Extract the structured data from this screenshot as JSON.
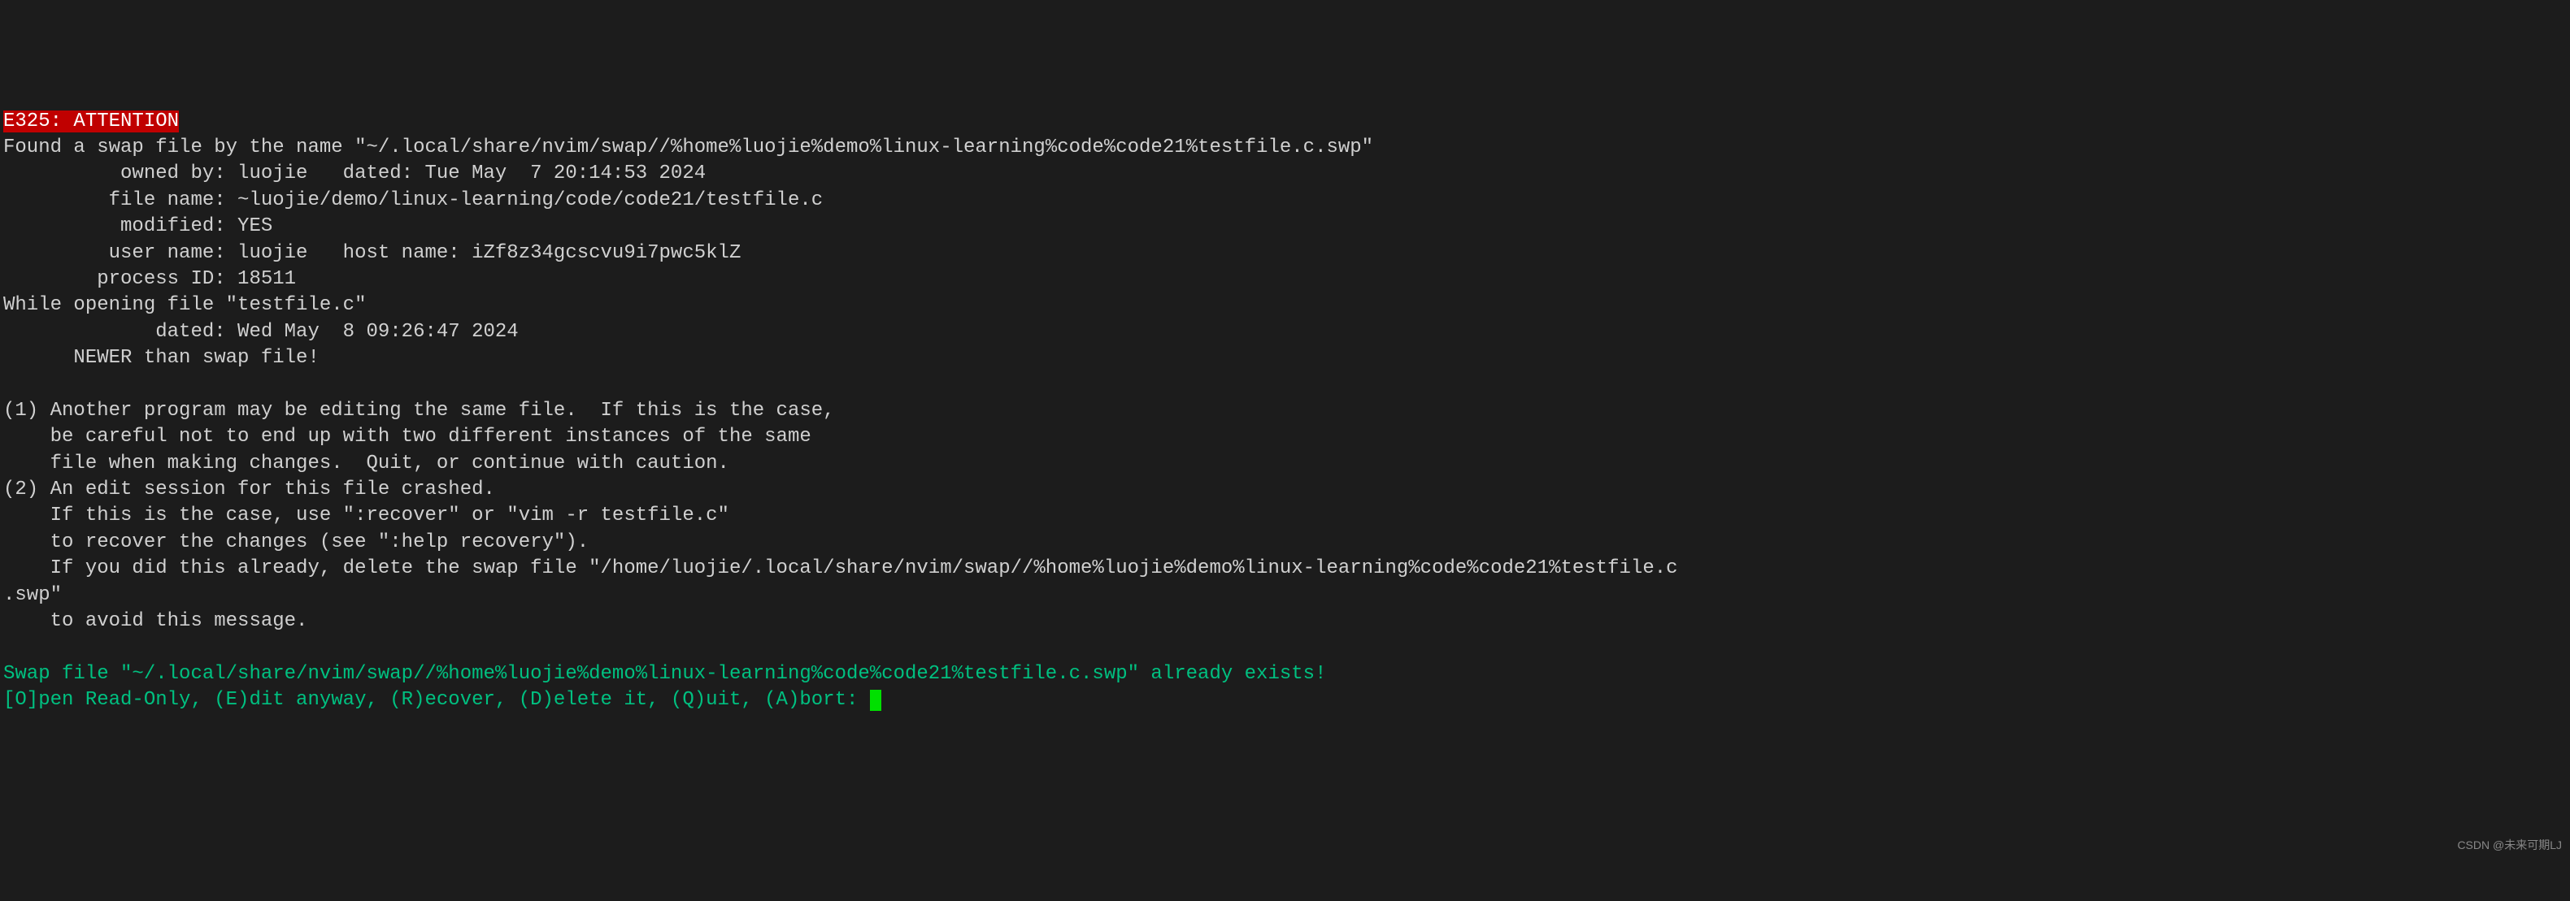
{
  "header": {
    "error_code": "E325: ATTENTION"
  },
  "swap_info": {
    "found_line": "Found a swap file by the name \"~/.local/share/nvim/swap//%home%luojie%demo%linux-learning%code%code21%testfile.c.swp\"",
    "owned_by": "          owned by: luojie   dated: Tue May  7 20:14:53 2024",
    "file_name": "         file name: ~luojie/demo/linux-learning/code/code21/testfile.c",
    "modified": "          modified: YES",
    "user_host": "         user name: luojie   host name: iZf8z34gcscvu9i7pwc5klZ",
    "process_id": "        process ID: 18511"
  },
  "while_opening": {
    "line": "While opening file \"testfile.c\"",
    "dated": "             dated: Wed May  8 09:26:47 2024",
    "newer": "      NEWER than swap file!"
  },
  "advice": {
    "p1a": "(1) Another program may be editing the same file.  If this is the case,",
    "p1b": "    be careful not to end up with two different instances of the same",
    "p1c": "    file when making changes.  Quit, or continue with caution.",
    "p2a": "(2) An edit session for this file crashed.",
    "p2b": "    If this is the case, use \":recover\" or \"vim -r testfile.c\"",
    "p2c": "    to recover the changes (see \":help recovery\").",
    "p2d": "    If you did this already, delete the swap file \"/home/luojie/.local/share/nvim/swap//%home%luojie%demo%linux-learning%code%code21%testfile.c",
    "p2e": ".swp\"",
    "p2f": "    to avoid this message."
  },
  "prompt": {
    "exists": "Swap file \"~/.local/share/nvim/swap//%home%luojie%demo%linux-learning%code%code21%testfile.c.swp\" already exists!",
    "options": "[O]pen Read-Only, (E)dit anyway, (R)ecover, (D)elete it, (Q)uit, (A)bort: "
  },
  "watermark": "CSDN @未来可期LJ"
}
